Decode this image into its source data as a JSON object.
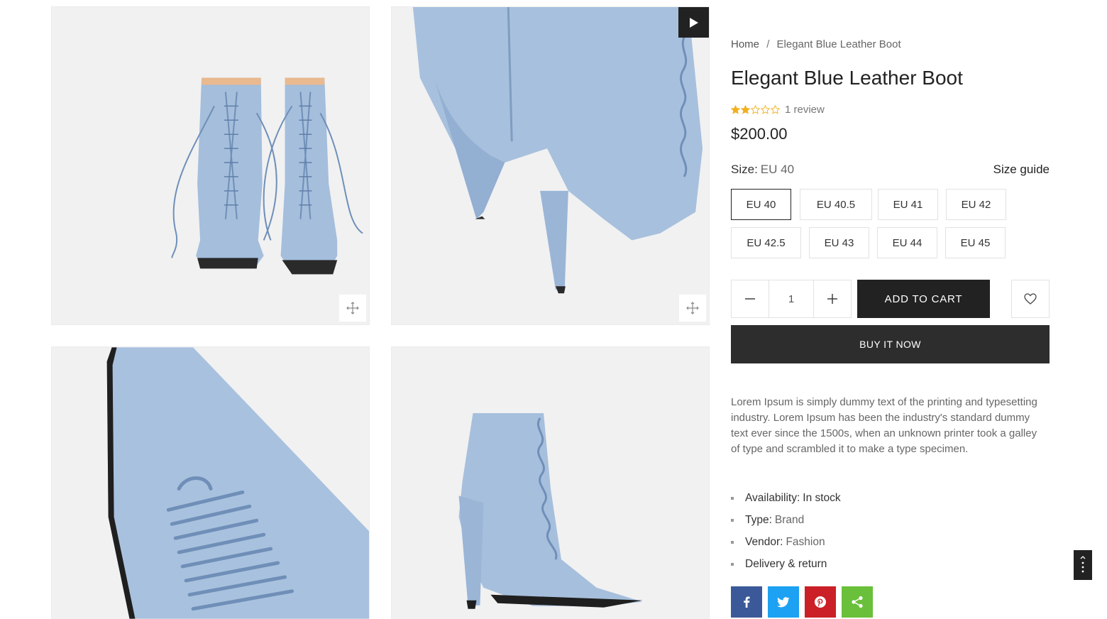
{
  "breadcrumb": {
    "home": "Home",
    "separator": "/",
    "current": "Elegant Blue Leather Boot"
  },
  "product": {
    "title": "Elegant Blue Leather Boot",
    "rating": 2,
    "rating_max": 5,
    "review_text": "1 review",
    "price": "$200.00",
    "description": "Lorem Ipsum is simply dummy text of the printing and typesetting industry. Lorem Ipsum has been the industry's standard dummy text ever since the 1500s, when an unknown printer took a galley of type and scrambled it to make a type specimen."
  },
  "size": {
    "label": "Size:",
    "selected": "EU 40",
    "guide_label": "Size guide",
    "options": [
      "EU 40",
      "EU 40.5",
      "EU 41",
      "EU 42",
      "EU 42.5",
      "EU 43",
      "EU 44",
      "EU 45"
    ]
  },
  "quantity": {
    "value": "1",
    "decrease_icon": "minus-icon",
    "increase_icon": "plus-icon"
  },
  "actions": {
    "add_to_cart": "ADD TO CART",
    "buy_now": "BUY IT NOW",
    "wishlist_icon": "heart-icon"
  },
  "meta": {
    "availability_label": "Availability:",
    "availability_value": "In stock",
    "type_label": "Type:",
    "type_value": "Brand",
    "vendor_label": "Vendor:",
    "vendor_value": "Fashion",
    "delivery_label": "Delivery & return"
  },
  "share": [
    {
      "icon": "facebook-icon",
      "color": "#3b5998"
    },
    {
      "icon": "twitter-icon",
      "color": "#1da1f2"
    },
    {
      "icon": "pinterest-icon",
      "color": "#cb2027"
    },
    {
      "icon": "share-icon",
      "color": "#6ac03a"
    }
  ],
  "colors": {
    "boot": "#9fb9d8",
    "boot_shadow": "#7f9dc2",
    "dark": "#222222",
    "star": "#f2b01e"
  }
}
